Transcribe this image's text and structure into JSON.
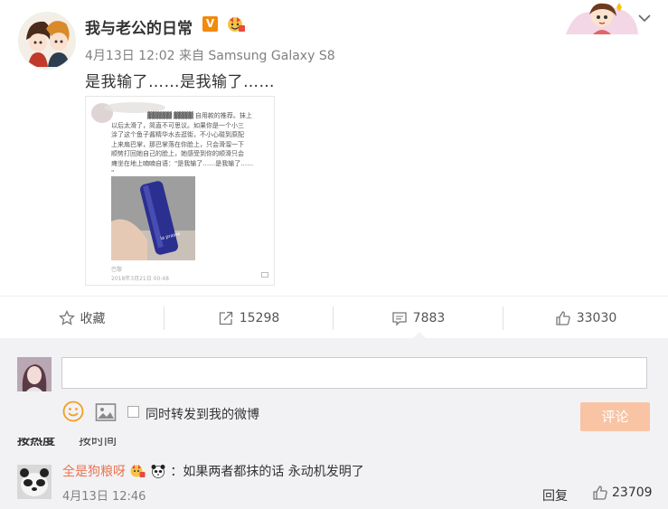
{
  "post": {
    "username": "我与老公的日常",
    "verified_label": "V",
    "meta": "4月13日 12:02 来自 Samsung Galaxy S8",
    "text": "是我输了……是我输了……",
    "image": {
      "text_lines": [
        "▓▓▓▓▓ ▓▓▓▓ 自用款的推荐。抹上",
        "以后太滑了，简直不可思议。如果你是一个小三",
        "涂了这个鱼子酱精华水去逛街，不小心碰到原配",
        "上来扇巴掌，那巴掌落在你脸上，只会滑溜一下",
        "顺势打回她自己的脸上，她感受到你的顺滑只会",
        "瘫坐在地上喃喃自语：\"是我输了……是我输了……",
        "\""
      ],
      "bottle_label": "la prairie",
      "footer_name": "巴黎",
      "footer_date": "2018年3月21日 00:48"
    }
  },
  "actions": {
    "favorite_label": "收藏",
    "repost_count": "15298",
    "comment_count": "7883",
    "like_count": "33030"
  },
  "composer": {
    "input_value": "",
    "repost_checkbox_label": "同时转发到我的微博",
    "submit_label": "评论"
  },
  "tabs": {
    "hot_label": "按热度",
    "time_label": "按时间"
  },
  "comment": {
    "username": "全是狗粮呀",
    "text": "：如果两者都抹的话 永动机发明了",
    "time": "4月13日 12:46",
    "reply_label": "回复",
    "like_count": "23709"
  },
  "colors": {
    "accent_orange": "#eb7350",
    "submit_disabled": "#f8c4a4",
    "panel_bg": "#f2f2f5",
    "verified_badge": "#f28a0c"
  }
}
